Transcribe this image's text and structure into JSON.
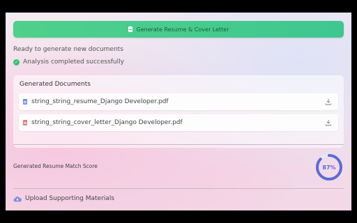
{
  "actions": {
    "generate_label": "Generate Resume & Cover Letter"
  },
  "status": {
    "ready_text": "Ready to generate new documents",
    "success_text": "Analysis completed successfully"
  },
  "documents": {
    "title": "Generated Documents",
    "items": [
      {
        "name": "string_string_resume_Django Developer.pdf",
        "icon": "blue-pdf-icon"
      },
      {
        "name": "string_string_cover_letter_Django Developer.pdf",
        "icon": "red-pdf-icon"
      }
    ]
  },
  "score": {
    "label": "Generated Resume Match Score",
    "value": 87,
    "display": "87%"
  },
  "upload": {
    "label": "Upload Supporting Materials"
  },
  "colors": {
    "accent_green": "#3ec790",
    "score_ring": "#5a6bd8"
  }
}
